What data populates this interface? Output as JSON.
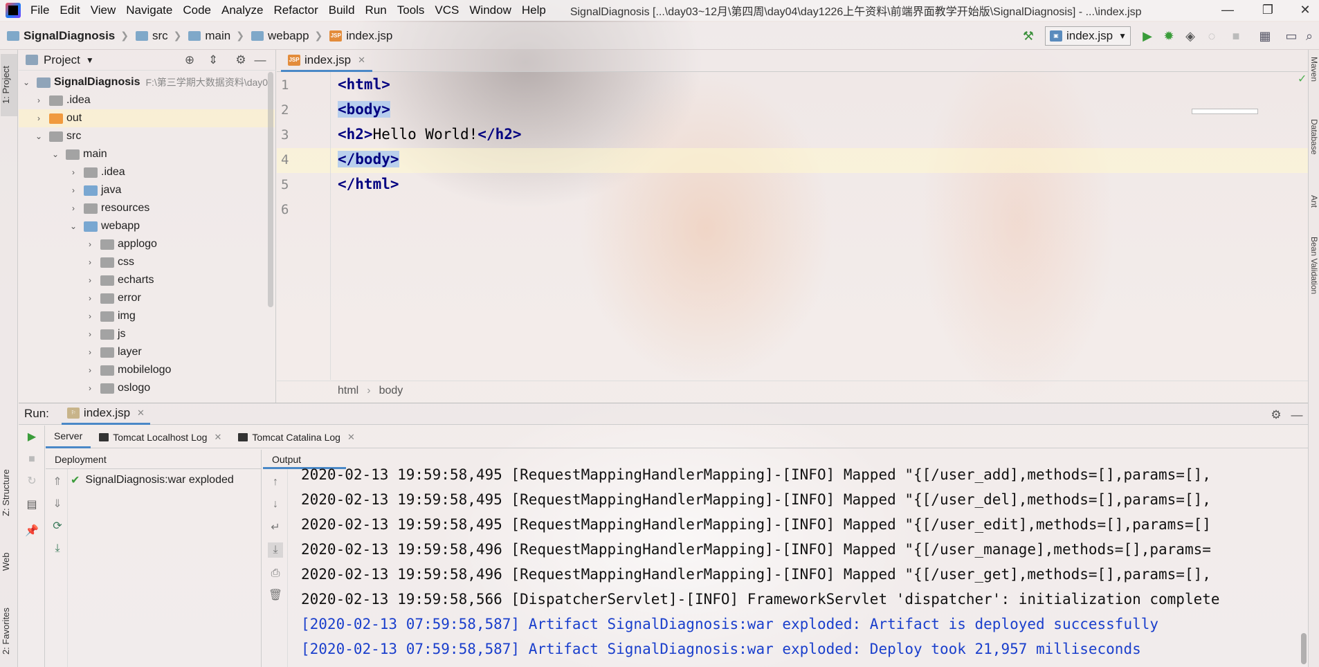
{
  "window": {
    "title": "SignalDiagnosis [...\\day03~12月\\第四周\\day04\\day1226上午资料\\前端界面教学开始版\\SignalDiagnosis] - ...\\index.jsp",
    "minimize": "—",
    "restore": "❐",
    "close": "✕"
  },
  "menu": [
    "File",
    "Edit",
    "View",
    "Navigate",
    "Code",
    "Analyze",
    "Refactor",
    "Build",
    "Run",
    "Tools",
    "VCS",
    "Window",
    "Help"
  ],
  "breadcrumb": [
    "SignalDiagnosis",
    "src",
    "main",
    "webapp",
    "index.jsp"
  ],
  "toolbar": {
    "run_config": "index.jsp"
  },
  "left_strip": {
    "project": "1: Project",
    "structure": "Z: Structure",
    "web": "Web",
    "favorites": "2: Favorites"
  },
  "right_strip": {
    "maven": "Maven",
    "database": "Database",
    "ant": "Ant",
    "bean_validation": "Bean Validation"
  },
  "project_panel": {
    "title": "Project",
    "root": {
      "name": "SignalDiagnosis",
      "path": "F:\\第三学期大数据资料\\day0"
    },
    "items": [
      {
        "label": ".idea"
      },
      {
        "label": "out"
      },
      {
        "label": "src"
      },
      {
        "label": "main"
      },
      {
        "label": ".idea"
      },
      {
        "label": "java"
      },
      {
        "label": "resources"
      },
      {
        "label": "webapp"
      },
      {
        "label": "applogo"
      },
      {
        "label": "css"
      },
      {
        "label": "echarts"
      },
      {
        "label": "error"
      },
      {
        "label": "img"
      },
      {
        "label": "js"
      },
      {
        "label": "layer"
      },
      {
        "label": "mobilelogo"
      },
      {
        "label": "oslogo"
      }
    ]
  },
  "editor": {
    "tab": "index.jsp",
    "line_numbers": [
      "1",
      "2",
      "3",
      "4",
      "5",
      "6"
    ],
    "lines": {
      "l1_open": "<html>",
      "l2": "<body>",
      "l3_open": "<h2>",
      "l3_text": "Hello World!",
      "l3_close": "</h2>",
      "l4": "</body>",
      "l5": "</html>"
    },
    "crumb": [
      "html",
      "body"
    ]
  },
  "run_panel": {
    "label": "Run:",
    "tab": "index.jsp",
    "server_tabs": [
      "Server",
      "Tomcat Localhost Log",
      "Tomcat Catalina Log"
    ],
    "deployment_header": "Deployment",
    "deployment_item": "SignalDiagnosis:war exploded",
    "output_header": "Output",
    "log_lines": [
      "2020-02-13 19:59:58,495 [RequestMappingHandlerMapping]-[INFO] Mapped \"{[/user_add],methods=[],params=[],",
      "2020-02-13 19:59:58,495 [RequestMappingHandlerMapping]-[INFO] Mapped \"{[/user_del],methods=[],params=[],",
      "2020-02-13 19:59:58,495 [RequestMappingHandlerMapping]-[INFO] Mapped \"{[/user_edit],methods=[],params=[]",
      "2020-02-13 19:59:58,496 [RequestMappingHandlerMapping]-[INFO] Mapped \"{[/user_manage],methods=[],params=",
      "2020-02-13 19:59:58,496 [RequestMappingHandlerMapping]-[INFO] Mapped \"{[/user_get],methods=[],params=[],",
      "2020-02-13 19:59:58,566 [DispatcherServlet]-[INFO] FrameworkServlet 'dispatcher': initialization complete"
    ],
    "artifact_lines": [
      "[2020-02-13 07:59:58,587] Artifact SignalDiagnosis:war exploded: Artifact is deployed successfully",
      "[2020-02-13 07:59:58,587] Artifact SignalDiagnosis:war exploded: Deploy took 21,957 milliseconds"
    ]
  }
}
